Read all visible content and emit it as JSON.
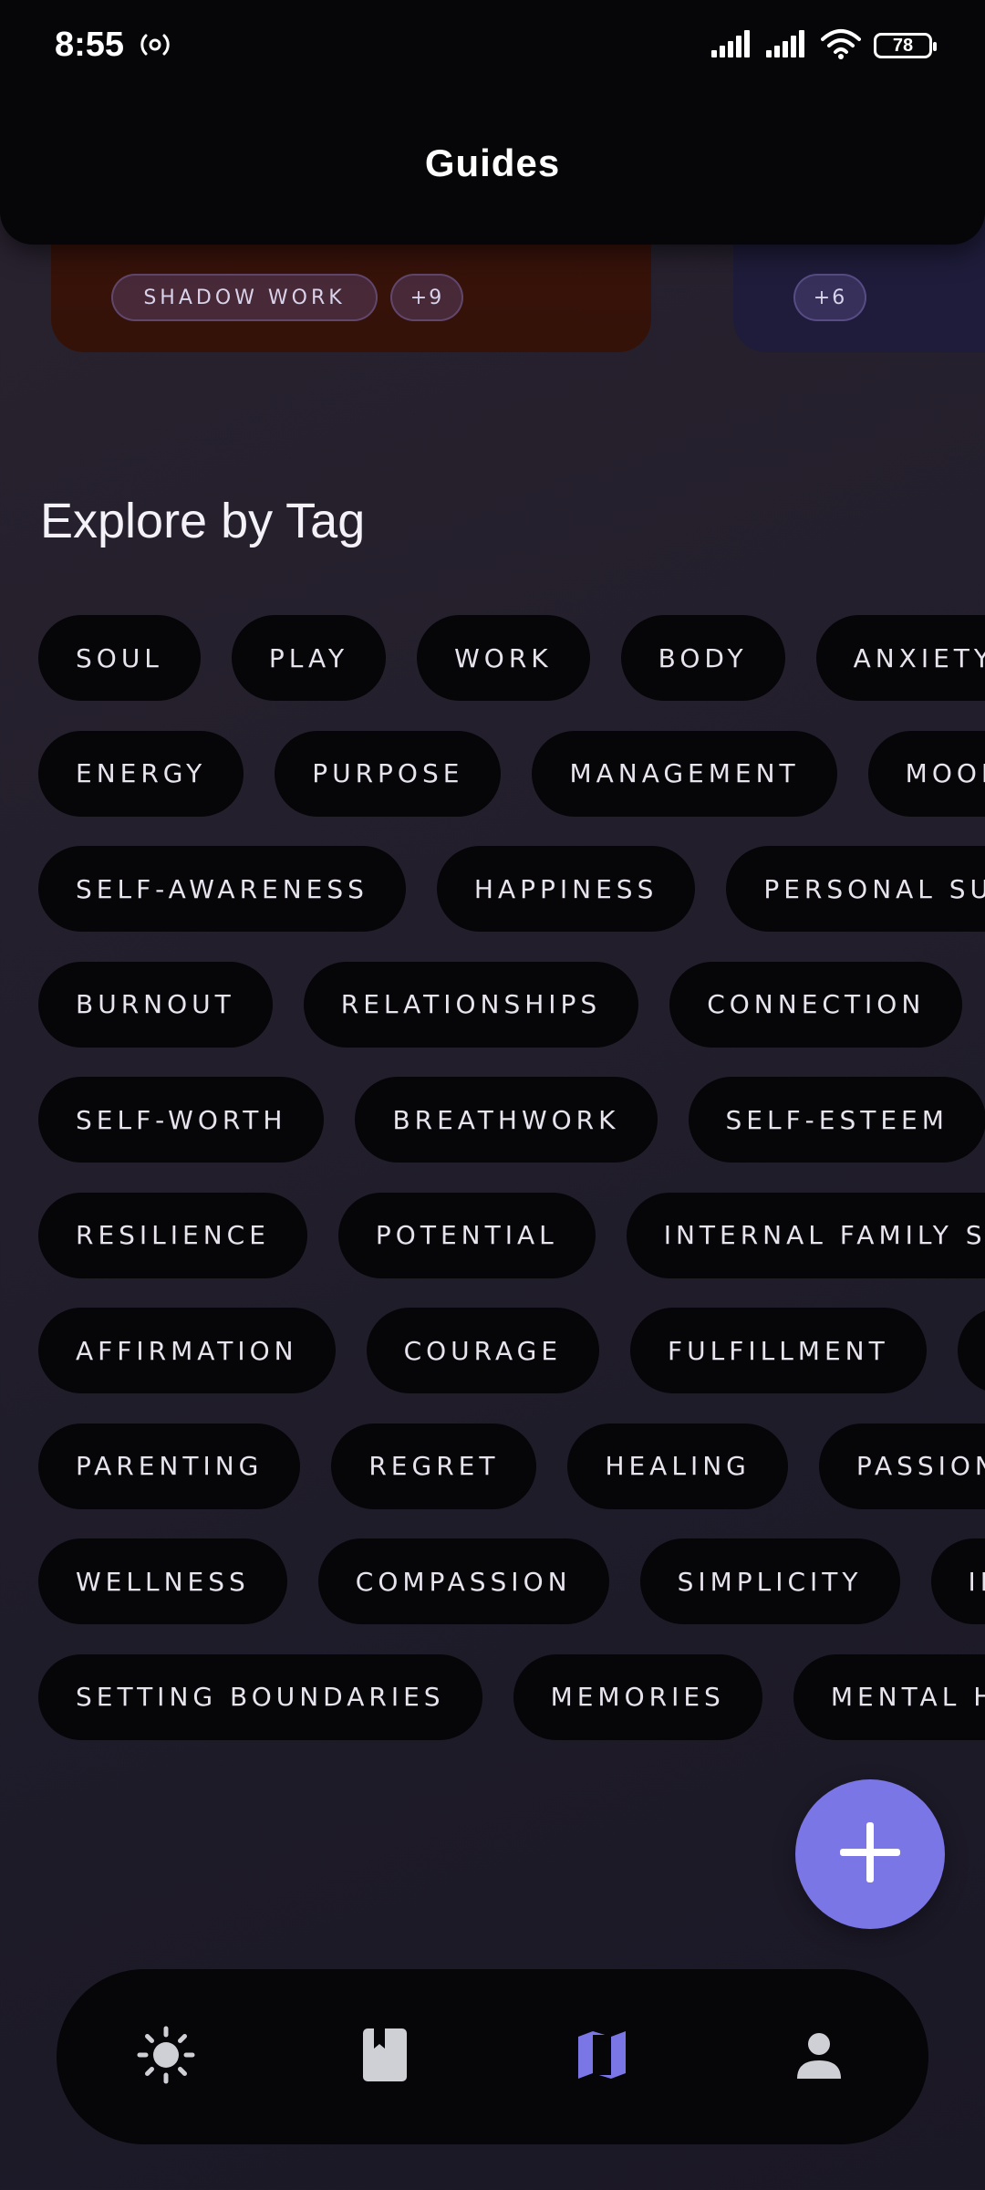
{
  "status_bar": {
    "time": "8:55",
    "battery": "78"
  },
  "header": {
    "title": "Guides"
  },
  "guide_cards": [
    {
      "tags": [
        "SHADOW WORK",
        "+9"
      ],
      "color": "#3b130c"
    },
    {
      "tags": [
        "+6"
      ],
      "color": "#1e1c3a"
    }
  ],
  "explore": {
    "title": "Explore by Tag",
    "rows": [
      [
        "SOUL",
        "PLAY",
        "WORK",
        "BODY",
        "ANXIETY"
      ],
      [
        "ENERGY",
        "PURPOSE",
        "MANAGEMENT",
        "MOON"
      ],
      [
        "SELF-AWARENESS",
        "HAPPINESS",
        "PERSONAL SU"
      ],
      [
        "BURNOUT",
        "RELATIONSHIPS",
        "CONNECTION"
      ],
      [
        "SELF-WORTH",
        "BREATHWORK",
        "SELF-ESTEEM"
      ],
      [
        "RESILIENCE",
        "POTENTIAL",
        "INTERNAL FAMILY SY"
      ],
      [
        "AFFIRMATION",
        "COURAGE",
        "FULFILLMENT"
      ],
      [
        "PARENTING",
        "REGRET",
        "HEALING",
        "PASSION"
      ],
      [
        "WELLNESS",
        "COMPASSION",
        "SIMPLICITY",
        "IN"
      ],
      [
        "SETTING BOUNDARIES",
        "MEMORIES",
        "MENTAL H"
      ]
    ]
  },
  "fab": {
    "icon": "plus-icon",
    "color": "#7a76e6"
  },
  "bottom_nav": {
    "items": [
      {
        "icon": "sun-icon",
        "active": false
      },
      {
        "icon": "book-icon",
        "active": false
      },
      {
        "icon": "map-icon",
        "active": true
      },
      {
        "icon": "person-icon",
        "active": false
      }
    ],
    "active_color": "#7a76e6",
    "inactive_color": "#cfcfd6"
  }
}
